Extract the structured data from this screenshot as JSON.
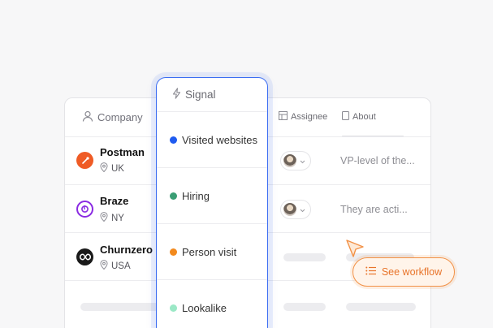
{
  "colors": {
    "accent_blue": "#3b6df2",
    "accent_orange": "#f29146",
    "postman": "#ef5b25",
    "braze": "#8a2be2",
    "churnzero": "#1a1a1a"
  },
  "table": {
    "headers": {
      "company": "Company",
      "assignee": "Assignee",
      "about": "About"
    },
    "rows": [
      {
        "name": "Postman",
        "location": "UK",
        "about": "VP-level of the...",
        "logo_icon": "postman-logo"
      },
      {
        "name": "Braze",
        "location": "NY",
        "about": "They are acti...",
        "logo_icon": "braze-logo"
      },
      {
        "name": "Churnzero",
        "location": "USA",
        "about": "",
        "logo_icon": "churnzero-logo"
      }
    ]
  },
  "signal": {
    "header": "Signal",
    "items": [
      {
        "label": "Visited websites",
        "color": "#1f5bf0"
      },
      {
        "label": "Hiring",
        "color": "#3a9e74"
      },
      {
        "label": "Person visit",
        "color": "#f28a1e"
      },
      {
        "label": "Lookalike",
        "color": "#9be8c6"
      }
    ]
  },
  "workflow_button": {
    "label": "See workflow",
    "icon": "list-icon"
  }
}
